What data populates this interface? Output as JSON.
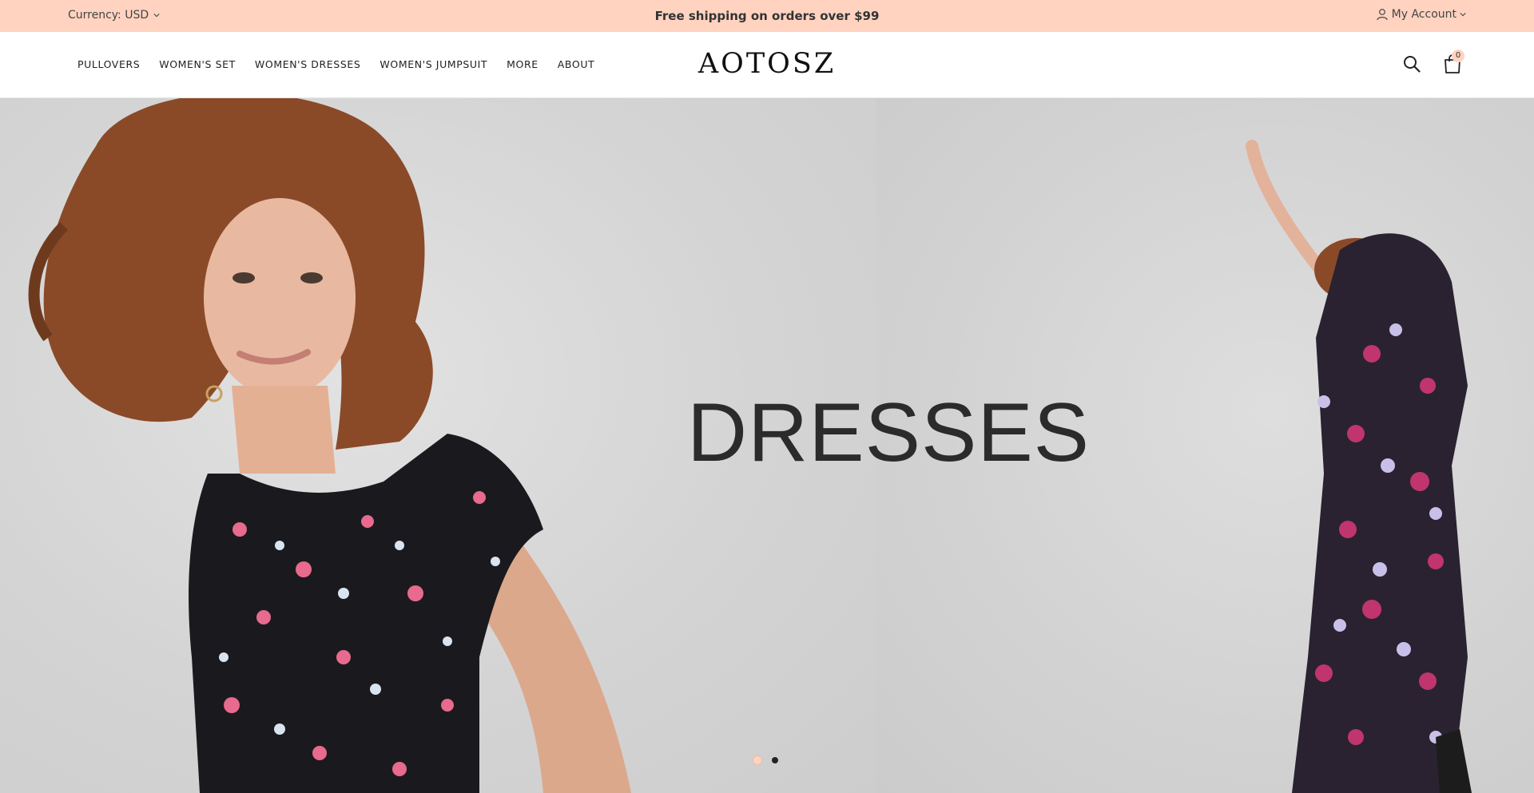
{
  "topbar": {
    "currency_label": "Currency: USD",
    "announcement": "Free shipping on orders over $99",
    "account_label": "My Account",
    "background": "#ffd3c0"
  },
  "header": {
    "logo": "AOTOSZ",
    "nav": [
      "PULLOVERS",
      "WOMEN'S SET",
      "WOMEN'S DRESSES",
      "WOMEN'S JUMPSUIT",
      "MORE",
      "ABOUT"
    ],
    "cart_count": "0",
    "icons": [
      "search-icon",
      "cart-icon",
      "user-icon"
    ]
  },
  "hero": {
    "title": "DRESSES",
    "slides_total": 2,
    "active_slide": 1,
    "images": [
      "woman-floral-dress-portrait",
      "woman-floral-maxi-dress-full-body"
    ]
  }
}
